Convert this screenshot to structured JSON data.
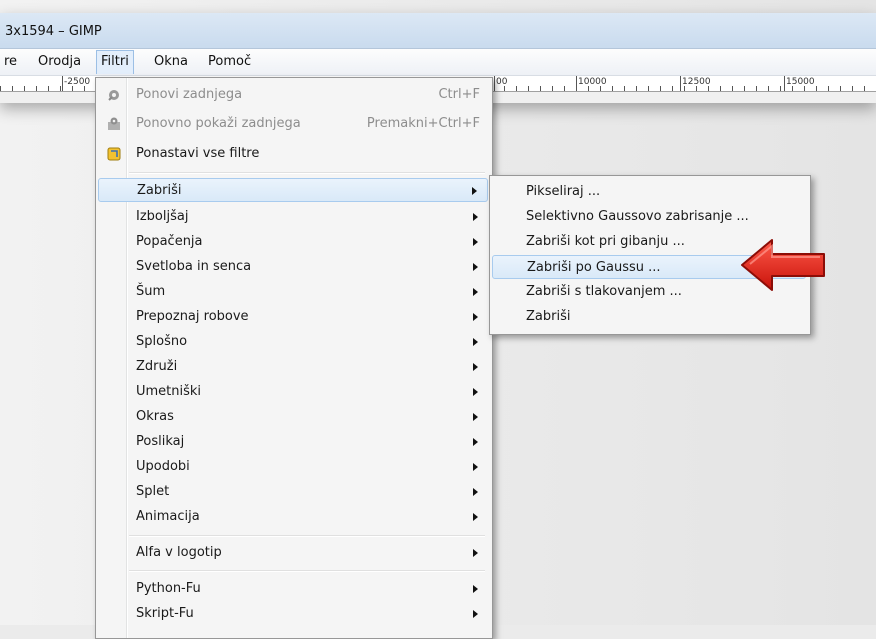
{
  "window": {
    "title": "3x1594 – GIMP"
  },
  "menubar": {
    "items": [
      {
        "label": "re"
      },
      {
        "label": "Orodja"
      },
      {
        "label": "Filtri"
      },
      {
        "label": "Okna"
      },
      {
        "label": "Pomoč"
      }
    ]
  },
  "ruler": {
    "labels": [
      "-2500",
      "10000",
      "12500",
      "15000"
    ],
    "partial_label": "00"
  },
  "filters_menu": {
    "items": [
      {
        "label": "Ponovi zadnjega",
        "shortcut": "Ctrl+F"
      },
      {
        "label": "Ponovno pokaži zadnjega",
        "shortcut": "Premakni+Ctrl+F"
      },
      {
        "label": "Ponastavi vse filtre"
      },
      {
        "label": "Zabriši"
      },
      {
        "label": "Izboljšaj"
      },
      {
        "label": "Popačenja"
      },
      {
        "label": "Svetloba in senca"
      },
      {
        "label": "Šum"
      },
      {
        "label": "Prepoznaj robove"
      },
      {
        "label": "Splošno"
      },
      {
        "label": "Združi"
      },
      {
        "label": "Umetniški"
      },
      {
        "label": "Okras"
      },
      {
        "label": "Poslikaj"
      },
      {
        "label": "Upodobi"
      },
      {
        "label": "Splet"
      },
      {
        "label": "Animacija"
      },
      {
        "label": "Alfa v logotip"
      },
      {
        "label": "Python-Fu"
      },
      {
        "label": "Skript-Fu"
      }
    ]
  },
  "blur_submenu": {
    "items": [
      {
        "label": "Pikseliraj ..."
      },
      {
        "label": "Selektivno Gaussovo zabrisanje ..."
      },
      {
        "label": "Zabriši kot pri gibanju ..."
      },
      {
        "label": "Zabriši po Gaussu ..."
      },
      {
        "label": "Zabriši s tlakovanjem ..."
      },
      {
        "label": "Zabriši"
      }
    ]
  },
  "icons": {
    "repeat": "gear-icon",
    "reshow": "gear-dialog-icon",
    "reset": "reset-filters-icon",
    "pointer": "red-arrow-icon"
  },
  "colors": {
    "highlight": "#d9e9f8",
    "highlight_border": "#a8cbee",
    "arrow": "#e8201a"
  }
}
